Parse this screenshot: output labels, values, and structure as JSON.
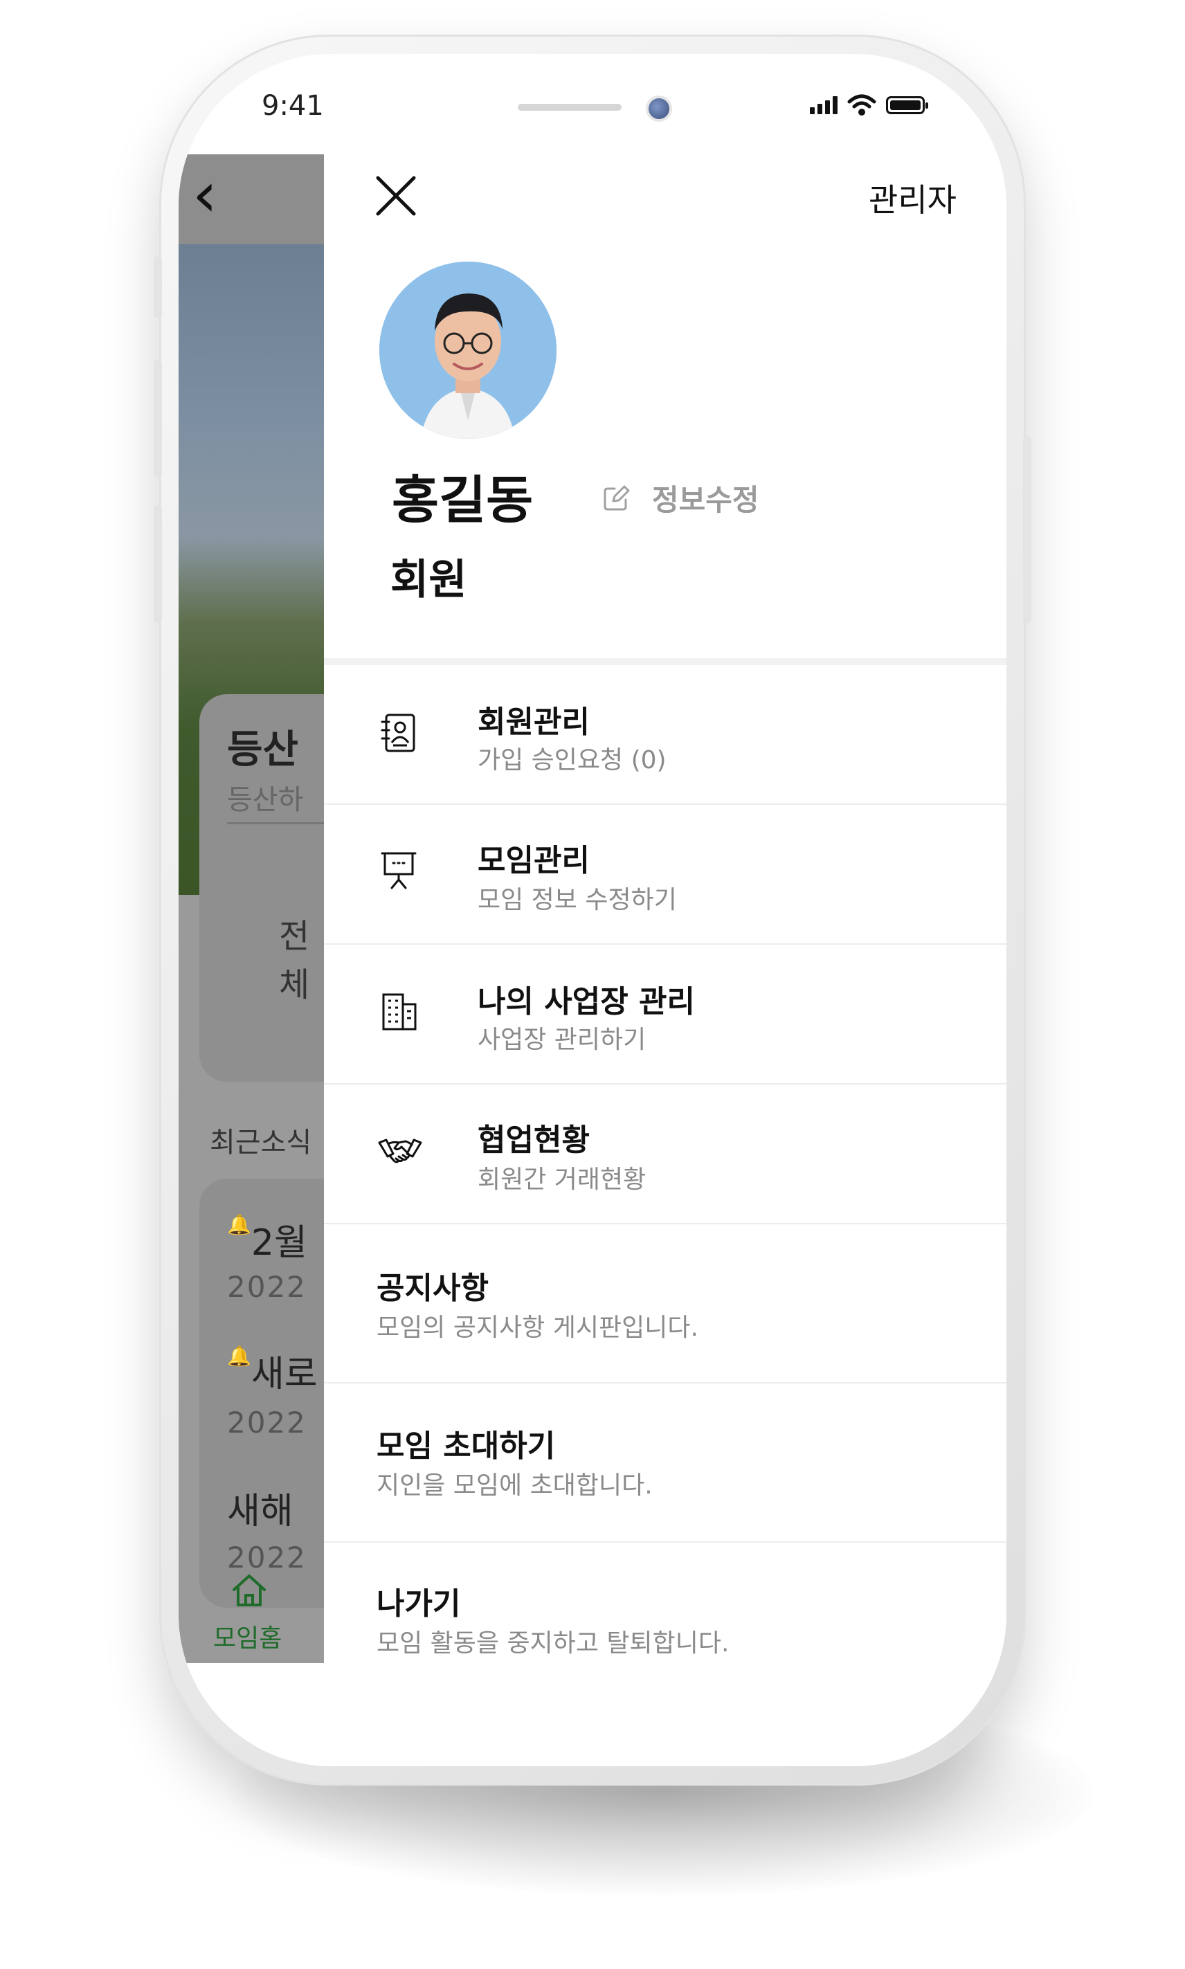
{
  "status_bar": {
    "time": "9:41"
  },
  "background_app": {
    "title_partial": "등산",
    "subtitle_partial": "등산하",
    "total_partial": "전체",
    "recent_label_partial": "최근소식",
    "news": [
      {
        "title_partial": "2월",
        "year_partial": "2022",
        "alert": true
      },
      {
        "title_partial": "새로",
        "year_partial": "2022",
        "alert": true
      },
      {
        "title_partial": "새해",
        "year_partial": "2022",
        "alert": false
      }
    ],
    "tab_home_label": "모임홈"
  },
  "drawer": {
    "admin_label": "관리자",
    "user": {
      "name": "홍길동",
      "role": "회원",
      "edit_label": "정보수정"
    },
    "menu": [
      {
        "title": "회원관리",
        "subtitle": "가입 승인요청 (0)",
        "icon": "member-book-icon"
      },
      {
        "title": "모임관리",
        "subtitle": "모임 정보 수정하기",
        "icon": "presentation-board-icon"
      },
      {
        "title": "나의 사업장 관리",
        "subtitle": "사업장 관리하기",
        "icon": "building-icon"
      },
      {
        "title": "협업현황",
        "subtitle": "회원간 거래현황",
        "icon": "handshake-icon"
      },
      {
        "title": "공지사항",
        "subtitle": "모임의 공지사항 게시판입니다."
      },
      {
        "title": "모임 초대하기",
        "subtitle": "지인을 모임에 초대합니다."
      },
      {
        "title": "나가기",
        "subtitle": "모임 활동을 중지하고 탈퇴합니다."
      }
    ]
  },
  "colors": {
    "accent_green": "#1f6b2a",
    "avatar_bg": "#8fc0ea",
    "alert_red": "#b01818"
  }
}
